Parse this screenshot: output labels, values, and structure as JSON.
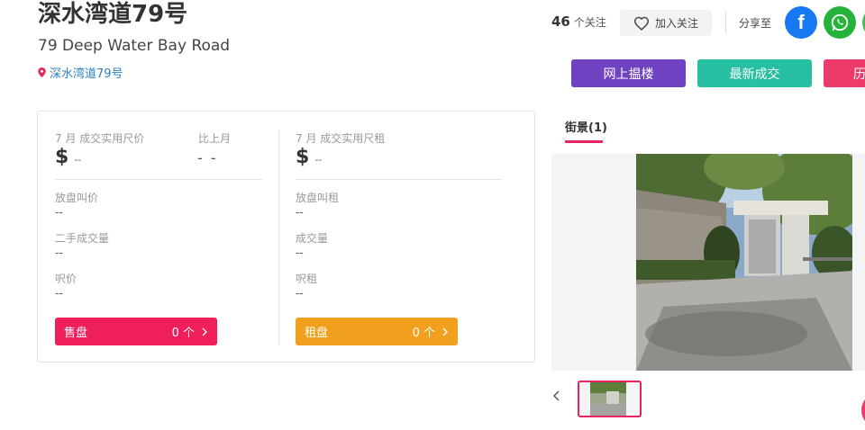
{
  "header": {
    "title": "深水湾道79号",
    "subtitle": "79 Deep Water Bay Road",
    "location": "深水湾道79号"
  },
  "social": {
    "follow_count": "46",
    "follow_unit": "个关注",
    "follow_label": "加入关注",
    "share_label": "分享至",
    "facebook_glyph": "f"
  },
  "actions": {
    "online_viewing": "网上揾楼",
    "latest_deals": "最新成交",
    "history": "历"
  },
  "stats": {
    "left": {
      "price_label": "7 月 成交实用尺价",
      "currency": "$",
      "price_value": "--",
      "mom_label": "比上月",
      "mom_value": "- -",
      "asking_label": "放盘叫价",
      "asking_value": "--",
      "volume_label": "二手成交量",
      "volume_value": "--",
      "ask_label": "呎价",
      "ask_value": "--",
      "pill_label": "售盘",
      "pill_count": "0 个"
    },
    "right": {
      "rent_label": "7 月 成交实用尺租",
      "currency": "$",
      "rent_value": "--",
      "asking_label": "放盘叫租",
      "asking_value": "--",
      "volume_label": "成交量",
      "volume_value": "--",
      "ask_label": "呎租",
      "ask_value": "--",
      "pill_label": "租盘",
      "pill_count": "0 个"
    }
  },
  "gallery": {
    "tab_label": "街景(1)"
  },
  "colors": {
    "accent": "#e6245e",
    "purple": "#6f42c1",
    "teal": "#26bfa1",
    "link": "#2d7fc1",
    "orange": "#f0a01c"
  }
}
